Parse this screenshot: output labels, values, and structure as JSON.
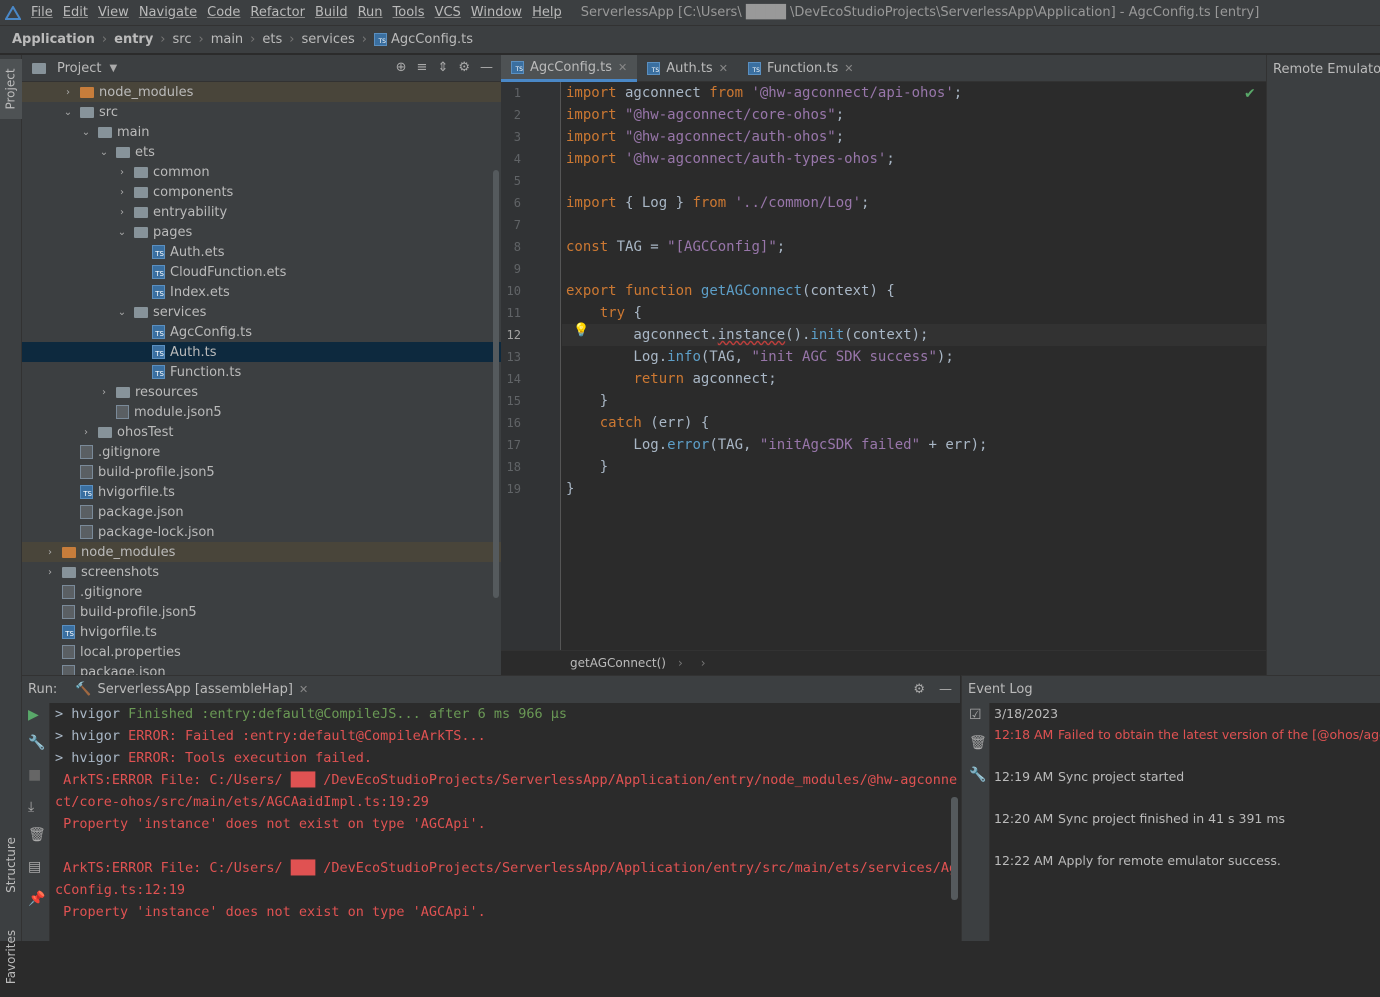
{
  "menubar": {
    "items": [
      "File",
      "Edit",
      "View",
      "Navigate",
      "Code",
      "Refactor",
      "Build",
      "Run",
      "Tools",
      "VCS",
      "Window",
      "Help"
    ],
    "window_title": "ServerlessApp [C:\\Users\\ ████ \\DevEcoStudioProjects\\ServerlessApp\\Application] - AgcConfig.ts [entry]"
  },
  "breadcrumb": [
    "Application",
    "entry",
    "src",
    "main",
    "ets",
    "services",
    "AgcConfig.ts"
  ],
  "sidebar": {
    "project_tab": "Project",
    "structure_tab": "Structure",
    "favorites_tab": "Favorites"
  },
  "project_panel": {
    "title": "Project",
    "tree": [
      {
        "label": "node_modules",
        "depth": 2,
        "type": "folder-orange",
        "arrow": "›",
        "state": "highlight"
      },
      {
        "label": "src",
        "depth": 2,
        "type": "folder",
        "arrow": "⌄"
      },
      {
        "label": "main",
        "depth": 3,
        "type": "folder",
        "arrow": "⌄"
      },
      {
        "label": "ets",
        "depth": 4,
        "type": "folder",
        "arrow": "⌄"
      },
      {
        "label": "common",
        "depth": 5,
        "type": "folder",
        "arrow": "›"
      },
      {
        "label": "components",
        "depth": 5,
        "type": "folder",
        "arrow": "›"
      },
      {
        "label": "entryability",
        "depth": 5,
        "type": "folder",
        "arrow": "›"
      },
      {
        "label": "pages",
        "depth": 5,
        "type": "folder",
        "arrow": "⌄"
      },
      {
        "label": "Auth.ets",
        "depth": 6,
        "type": "ts"
      },
      {
        "label": "CloudFunction.ets",
        "depth": 6,
        "type": "ts"
      },
      {
        "label": "Index.ets",
        "depth": 6,
        "type": "ts"
      },
      {
        "label": "services",
        "depth": 5,
        "type": "folder",
        "arrow": "⌄"
      },
      {
        "label": "AgcConfig.ts",
        "depth": 6,
        "type": "ts"
      },
      {
        "label": "Auth.ts",
        "depth": 6,
        "type": "ts",
        "state": "selected"
      },
      {
        "label": "Function.ts",
        "depth": 6,
        "type": "ts"
      },
      {
        "label": "resources",
        "depth": 4,
        "type": "folder",
        "arrow": "›"
      },
      {
        "label": "module.json5",
        "depth": 4,
        "type": "gen"
      },
      {
        "label": "ohosTest",
        "depth": 3,
        "type": "folder",
        "arrow": "›"
      },
      {
        "label": ".gitignore",
        "depth": 2,
        "type": "gen"
      },
      {
        "label": "build-profile.json5",
        "depth": 2,
        "type": "gen"
      },
      {
        "label": "hvigorfile.ts",
        "depth": 2,
        "type": "ts"
      },
      {
        "label": "package.json",
        "depth": 2,
        "type": "gen"
      },
      {
        "label": "package-lock.json",
        "depth": 2,
        "type": "gen"
      },
      {
        "label": "node_modules",
        "depth": 1,
        "type": "folder-orange",
        "arrow": "›",
        "state": "highlight"
      },
      {
        "label": "screenshots",
        "depth": 1,
        "type": "folder",
        "arrow": "›"
      },
      {
        "label": ".gitignore",
        "depth": 1,
        "type": "gen"
      },
      {
        "label": "build-profile.json5",
        "depth": 1,
        "type": "gen"
      },
      {
        "label": "hvigorfile.ts",
        "depth": 1,
        "type": "ts"
      },
      {
        "label": "local.properties",
        "depth": 1,
        "type": "gen"
      },
      {
        "label": "package.json",
        "depth": 1,
        "type": "gen"
      }
    ]
  },
  "editor": {
    "tabs": [
      {
        "label": "AgcConfig.ts",
        "active": true
      },
      {
        "label": "Auth.ts",
        "active": false
      },
      {
        "label": "Function.ts",
        "active": false
      }
    ],
    "right_panel_title": "Remote Emulator",
    "current_line": 12,
    "lines": [
      [
        [
          "kw2",
          "import"
        ],
        [
          "plain",
          " agconnect "
        ],
        [
          "kw2",
          "from"
        ],
        [
          "plain",
          " "
        ],
        [
          "str2",
          "'@hw-agconnect/api-ohos'"
        ],
        [
          "plain",
          ";"
        ]
      ],
      [
        [
          "kw2",
          "import"
        ],
        [
          "plain",
          " "
        ],
        [
          "str2",
          "\"@hw-agconnect/core-ohos\""
        ],
        [
          "plain",
          ";"
        ]
      ],
      [
        [
          "kw2",
          "import"
        ],
        [
          "plain",
          " "
        ],
        [
          "str2",
          "\"@hw-agconnect/auth-ohos\""
        ],
        [
          "plain",
          ";"
        ]
      ],
      [
        [
          "kw2",
          "import"
        ],
        [
          "plain",
          " "
        ],
        [
          "str2",
          "'@hw-agconnect/auth-types-ohos'"
        ],
        [
          "plain",
          ";"
        ]
      ],
      [],
      [
        [
          "kw2",
          "import"
        ],
        [
          "plain",
          " { Log } "
        ],
        [
          "kw2",
          "from"
        ],
        [
          "plain",
          " "
        ],
        [
          "str2",
          "'../common/Log'"
        ],
        [
          "plain",
          ";"
        ]
      ],
      [],
      [
        [
          "kw2",
          "const"
        ],
        [
          "plain",
          " TAG = "
        ],
        [
          "str2",
          "\"[AGCConfig]\""
        ],
        [
          "plain",
          ";"
        ]
      ],
      [],
      [
        [
          "kw2",
          "export"
        ],
        [
          "plain",
          " "
        ],
        [
          "kw2",
          "function"
        ],
        [
          "plain",
          " "
        ],
        [
          "mt",
          "getAGConnect"
        ],
        [
          "plain",
          "(context) {"
        ]
      ],
      [
        [
          "plain",
          "    "
        ],
        [
          "kw2",
          "try"
        ],
        [
          "plain",
          " {"
        ]
      ],
      [
        [
          "plain",
          "        agconnect."
        ],
        [
          "squig",
          "instance"
        ],
        [
          "plain",
          "()."
        ],
        [
          "mt",
          "init"
        ],
        [
          "plain",
          "(context);"
        ]
      ],
      [
        [
          "plain",
          "        Log."
        ],
        [
          "mt",
          "info"
        ],
        [
          "plain",
          "(TAG, "
        ],
        [
          "str2",
          "\"init AGC SDK success\""
        ],
        [
          "plain",
          ");"
        ]
      ],
      [
        [
          "plain",
          "        "
        ],
        [
          "kw2",
          "return"
        ],
        [
          "plain",
          " agconnect;"
        ]
      ],
      [
        [
          "plain",
          "    }"
        ]
      ],
      [
        [
          "plain",
          "    "
        ],
        [
          "kw2",
          "catch"
        ],
        [
          "plain",
          " (err) {"
        ]
      ],
      [
        [
          "plain",
          "        Log."
        ],
        [
          "mt",
          "error"
        ],
        [
          "plain",
          "(TAG, "
        ],
        [
          "str2",
          "\"initAgcSDK failed\""
        ],
        [
          "plain",
          " + err);"
        ]
      ],
      [
        [
          "plain",
          "    }"
        ]
      ],
      [
        [
          "plain",
          "}"
        ]
      ]
    ],
    "code_breadcrumb": "getAGConnect()"
  },
  "run_panel": {
    "label": "Run:",
    "tab": "ServerlessApp [assembleHap]",
    "lines": [
      [
        [
          "plain",
          "> hvigor "
        ],
        [
          "gr",
          "Finished :entry:default@CompileJS... after 6 ms 966 µs"
        ]
      ],
      [
        [
          "plain",
          "> hvigor "
        ],
        [
          "rd",
          "ERROR: Failed :entry:default@CompileArkTS..."
        ]
      ],
      [
        [
          "plain",
          "> hvigor "
        ],
        [
          "rd",
          "ERROR: Tools execution failed."
        ]
      ],
      [
        [
          "rd",
          " ArkTS:ERROR File: C:/Users/ ███ /DevEcoStudioProjects/ServerlessApp/Application/entry/node_modules/@hw-agconne"
        ]
      ],
      [
        [
          "rd",
          "ct/core-ohos/src/main/ets/AGCAaidImpl.ts:19:29"
        ]
      ],
      [
        [
          "rd",
          " Property 'instance' does not exist on type 'AGCApi'."
        ]
      ],
      [],
      [
        [
          "rd",
          " ArkTS:ERROR File: C:/Users/ ███ /DevEcoStudioProjects/ServerlessApp/Application/entry/src/main/ets/services/Ag"
        ]
      ],
      [
        [
          "rd",
          "cConfig.ts:12:19"
        ]
      ],
      [
        [
          "rd",
          " Property 'instance' does not exist on type 'AGCApi'."
        ]
      ]
    ]
  },
  "event_log": {
    "title": "Event Log",
    "date": "3/18/2023",
    "events": [
      {
        "time": "12:18 AM",
        "text": "Failed to obtain the latest version of the [@ohos/agcon",
        "error": true
      },
      {
        "time": "12:19 AM",
        "text": "Sync project started",
        "error": false
      },
      {
        "time": "12:20 AM",
        "text": "Sync project finished in 41 s 391 ms",
        "error": false
      },
      {
        "time": "12:22 AM",
        "text": "Apply for remote emulator success.",
        "error": false
      }
    ]
  },
  "colors": {
    "accent": "#4a88c7",
    "error": "#e05252",
    "success": "#6a9955",
    "keyword": "#cc7832",
    "string": "#9876aa"
  }
}
